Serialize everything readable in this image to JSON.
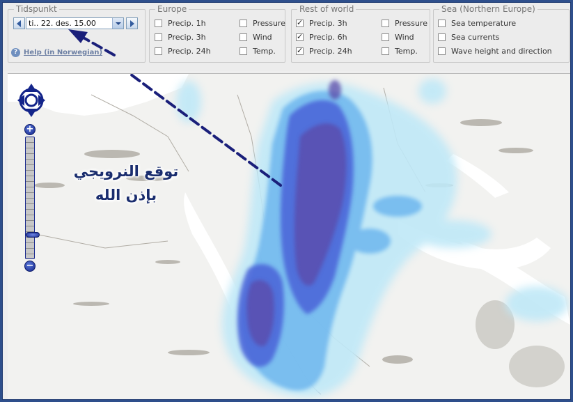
{
  "time_group": {
    "legend": "Tidspunkt",
    "selected_time": "ti.. 22. des. 15.00",
    "help_label": "Help (in Norwegian)"
  },
  "europe": {
    "legend": "Europe",
    "options": [
      {
        "label": "Precip. 1h",
        "checked": false
      },
      {
        "label": "Precip. 3h",
        "checked": false
      },
      {
        "label": "Precip. 24h",
        "checked": false
      },
      {
        "label": "Pressure",
        "checked": false
      },
      {
        "label": "Wind",
        "checked": false
      },
      {
        "label": "Temp.",
        "checked": false
      }
    ]
  },
  "rest_of_world": {
    "legend": "Rest of world",
    "options": [
      {
        "label": "Precip. 3h",
        "checked": true
      },
      {
        "label": "Precip. 6h",
        "checked": true
      },
      {
        "label": "Precip. 24h",
        "checked": true
      },
      {
        "label": "Pressure",
        "checked": false
      },
      {
        "label": "Wind",
        "checked": false
      },
      {
        "label": "Temp.",
        "checked": false
      }
    ]
  },
  "sea": {
    "legend": "Sea (Northern Europe)",
    "options": [
      {
        "label": "Sea temperature",
        "checked": false
      },
      {
        "label": "Sea currents",
        "checked": false
      },
      {
        "label": "Wave height and direction",
        "checked": false
      }
    ]
  },
  "map": {
    "annotation_line1": "توقع النرويجي",
    "annotation_line2": "بإذن الله",
    "zoom_in_symbol": "+",
    "zoom_out_symbol": "−",
    "colors": {
      "annotation_arrow": "#1a1f7a",
      "precip_light": "#bfe8f7",
      "precip_medium": "#6db6ee",
      "precip_heavy": "#4a62d8",
      "precip_extreme": "#5b4aa8",
      "land_features": "#a9a59c"
    }
  }
}
